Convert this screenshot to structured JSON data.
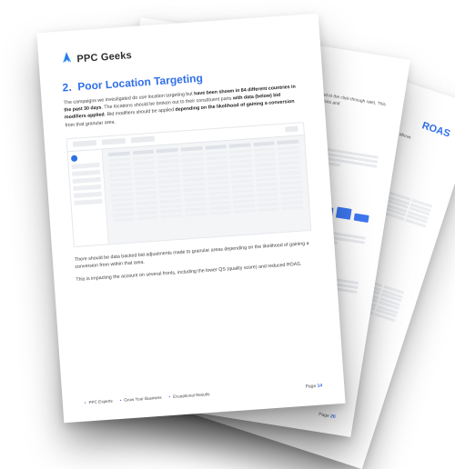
{
  "brand": {
    "name": "PPC Geeks"
  },
  "front": {
    "section_number": "2.",
    "section_title": "Poor Location Targeting",
    "para1_prefix": "The campaigns we investigated do use location targeting but ",
    "para1_bold1": "have been shown in 84 different countries in the past 30 days",
    "para1_mid": ". The locations should be broken out to their constituent parts ",
    "para1_bold2": "with data (below) bid modifiers applied",
    "para1_suffix": ". Bid modifiers should be applied ",
    "para1_bold3": "depending on the likelihood of gaining a conversion",
    "para1_end": " from that granular area.",
    "para2": "There should be data backed bid adjustments made to granular areas depending on the likelihood of gaining a conversion from within that area.",
    "para3": "This is impacting the account on several fronts, including the lower QS (quality score) and reduced ROAS.",
    "footer_links": [
      "PPC Experts",
      "Grow Your Business",
      "Exceptional Results"
    ],
    "page_label": "Page",
    "page_number": "14"
  },
  "middle": {
    "peek_body": "set ad extensions applied to the click-through rate). This will help you get more clicks and",
    "page_number": "20"
  },
  "back": {
    "peek_title": "ROAS",
    "peek_body": "perform overall above"
  }
}
